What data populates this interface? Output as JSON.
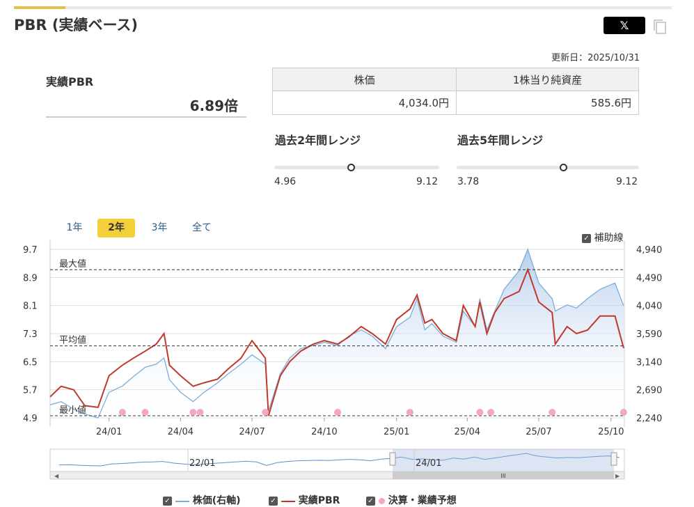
{
  "title": "PBR (実績ベース)",
  "share_label": "𝕏",
  "updated": "更新日：2025/10/31",
  "pbr": {
    "label": "実績PBR",
    "value": "6.89倍"
  },
  "table": {
    "h1": "株価",
    "h2": "1株当り純資産",
    "v1": "4,034.0円",
    "v2": "585.6円"
  },
  "range2": {
    "label": "過去2年間レンジ",
    "min": "4.96",
    "max": "9.12",
    "current": 6.89
  },
  "range5": {
    "label": "過去5年間レンジ",
    "min": "3.78",
    "max": "9.12",
    "current": 6.89
  },
  "periods": [
    "1年",
    "2年",
    "3年",
    "全て"
  ],
  "aux_label": "補助線",
  "legend": {
    "price": "株価(右軸)",
    "pbr": "実績PBR",
    "events": "決算・業績予想"
  },
  "colors": {
    "price": "#7aaedb",
    "pbr": "#c0392b",
    "event": "#f5a5c8",
    "accent": "#f3cf3a"
  },
  "chart_data": {
    "type": "line",
    "x_ticks": [
      "24/01",
      "24/04",
      "24/07",
      "24/10",
      "25/01",
      "25/04",
      "25/07",
      "25/10"
    ],
    "y_left_ticks": [
      "9.7",
      "8.9",
      "8.1",
      "7.3",
      "6.5",
      "5.7",
      "4.9"
    ],
    "y_right_ticks": [
      "4,940",
      "4,490",
      "4,040",
      "3,590",
      "3,140",
      "2,690",
      "2,240"
    ],
    "y_left_range": [
      4.9,
      9.7
    ],
    "y_right_range": [
      2240,
      4940
    ],
    "ref_lines": [
      {
        "label": "最大値",
        "value": 9.12
      },
      {
        "label": "平均値",
        "value": 6.95
      },
      {
        "label": "最小値",
        "value": 4.96
      }
    ],
    "x_range": [
      "2023/11",
      "2025/11"
    ],
    "pbr_series": [
      [
        "2023/11",
        5.5
      ],
      [
        "2023/11/15",
        5.8
      ],
      [
        "2023/12",
        5.7
      ],
      [
        "2023/12/15",
        5.25
      ],
      [
        "2024/01",
        5.2
      ],
      [
        "2024/01/15",
        6.1
      ],
      [
        "2024/02",
        6.4
      ],
      [
        "2024/02/15",
        6.6
      ],
      [
        "2024/03",
        6.8
      ],
      [
        "2024/03/15",
        7.0
      ],
      [
        "2024/03/25",
        7.3
      ],
      [
        "2024/04",
        6.4
      ],
      [
        "2024/04/15",
        6.1
      ],
      [
        "2024/05",
        5.8
      ],
      [
        "2024/05/15",
        5.9
      ],
      [
        "2024/06",
        6.0
      ],
      [
        "2024/06/15",
        6.3
      ],
      [
        "2024/07",
        6.6
      ],
      [
        "2024/07/15",
        7.1
      ],
      [
        "2024/08",
        6.6
      ],
      [
        "2024/08/05",
        4.96
      ],
      [
        "2024/08/20",
        6.1
      ],
      [
        "2024/09",
        6.5
      ],
      [
        "2024/09/15",
        6.8
      ],
      [
        "2024/10",
        7.0
      ],
      [
        "2024/10/15",
        7.1
      ],
      [
        "2024/11",
        7.0
      ],
      [
        "2024/11/15",
        7.2
      ],
      [
        "2024/12",
        7.5
      ],
      [
        "2024/12/15",
        7.3
      ],
      [
        "2025/01",
        7.0
      ],
      [
        "2025/01/15",
        7.7
      ],
      [
        "2025/02",
        8.0
      ],
      [
        "2025/02/10",
        8.4
      ],
      [
        "2025/02/20",
        7.6
      ],
      [
        "2025/03",
        7.7
      ],
      [
        "2025/03/15",
        7.3
      ],
      [
        "2025/04",
        7.1
      ],
      [
        "2025/04/10",
        8.1
      ],
      [
        "2025/04/25",
        7.5
      ],
      [
        "2025/05",
        8.2
      ],
      [
        "2025/05/10",
        7.3
      ],
      [
        "2025/05/20",
        7.9
      ],
      [
        "2025/06",
        8.3
      ],
      [
        "2025/06/20",
        8.5
      ],
      [
        "2025/07",
        9.12
      ],
      [
        "2025/07/15",
        8.2
      ],
      [
        "2025/08",
        7.9
      ],
      [
        "2025/08/05",
        7.0
      ],
      [
        "2025/08/20",
        7.5
      ],
      [
        "2025/09",
        7.3
      ],
      [
        "2025/09/15",
        7.4
      ],
      [
        "2025/10",
        7.8
      ],
      [
        "2025/10/20",
        7.8
      ],
      [
        "2025/10/31",
        6.89
      ]
    ],
    "price_series": [
      [
        "2023/11",
        2450
      ],
      [
        "2023/11/15",
        2500
      ],
      [
        "2023/12",
        2380
      ],
      [
        "2023/12/15",
        2300
      ],
      [
        "2024/01",
        2240
      ],
      [
        "2024/01/15",
        2650
      ],
      [
        "2024/02",
        2750
      ],
      [
        "2024/02/15",
        2900
      ],
      [
        "2024/03",
        3050
      ],
      [
        "2024/03/15",
        3100
      ],
      [
        "2024/03/25",
        3200
      ],
      [
        "2024/04",
        2850
      ],
      [
        "2024/04/15",
        2650
      ],
      [
        "2024/05",
        2500
      ],
      [
        "2024/05/15",
        2650
      ],
      [
        "2024/06",
        2800
      ],
      [
        "2024/06/15",
        2950
      ],
      [
        "2024/07",
        3100
      ],
      [
        "2024/07/15",
        3250
      ],
      [
        "2024/08",
        3100
      ],
      [
        "2024/08/05",
        2350
      ],
      [
        "2024/08/20",
        2950
      ],
      [
        "2024/09",
        3200
      ],
      [
        "2024/09/15",
        3350
      ],
      [
        "2024/10",
        3400
      ],
      [
        "2024/10/15",
        3450
      ],
      [
        "2024/11",
        3400
      ],
      [
        "2024/11/15",
        3550
      ],
      [
        "2024/12",
        3650
      ],
      [
        "2024/12/15",
        3550
      ],
      [
        "2025/01",
        3350
      ],
      [
        "2025/01/15",
        3700
      ],
      [
        "2025/02",
        3850
      ],
      [
        "2025/02/10",
        4150
      ],
      [
        "2025/02/20",
        3650
      ],
      [
        "2025/03",
        3750
      ],
      [
        "2025/03/15",
        3550
      ],
      [
        "2025/04",
        3450
      ],
      [
        "2025/04/10",
        3950
      ],
      [
        "2025/04/25",
        3700
      ],
      [
        "2025/05",
        4150
      ],
      [
        "2025/05/10",
        3650
      ],
      [
        "2025/05/20",
        3950
      ],
      [
        "2025/06",
        4300
      ],
      [
        "2025/06/20",
        4600
      ],
      [
        "2025/07",
        4940
      ],
      [
        "2025/07/15",
        4400
      ],
      [
        "2025/08",
        4150
      ],
      [
        "2025/08/05",
        3950
      ],
      [
        "2025/08/20",
        4050
      ],
      [
        "2025/09",
        4000
      ],
      [
        "2025/09/15",
        4150
      ],
      [
        "2025/10",
        4300
      ],
      [
        "2025/10/20",
        4400
      ],
      [
        "2025/10/31",
        4034
      ]
    ],
    "events": [
      "2024/02/01",
      "2024/03/01",
      "2024/05/01",
      "2024/05/10",
      "2024/08/01",
      "2024/11/01",
      "2025/02/01",
      "2025/05/01",
      "2025/05/15",
      "2025/08/01",
      "2025/10/31"
    ],
    "navigator_ticks": [
      "22/01",
      "24/01"
    ]
  }
}
